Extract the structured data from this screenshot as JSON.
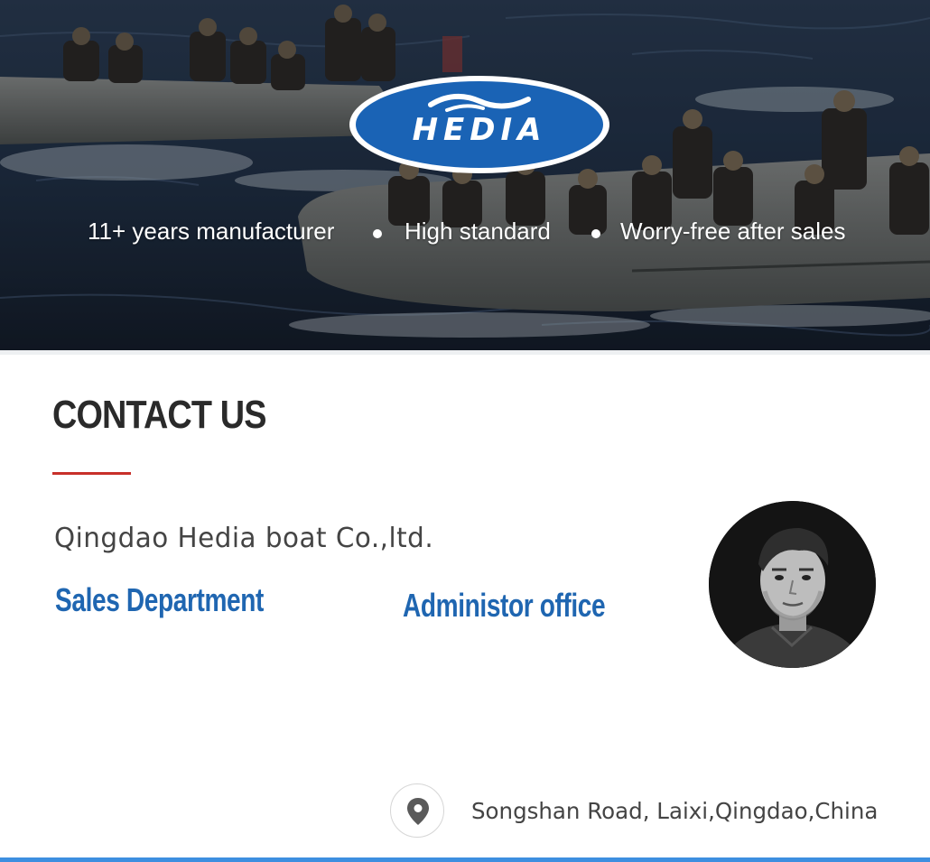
{
  "hero": {
    "brand": "HEDIA",
    "features": [
      "11+ years manufacturer",
      "High standard",
      "Worry-free after sales"
    ]
  },
  "contact": {
    "title": "CONTACT US",
    "company": "Qingdao Hedia boat Co.,ltd.",
    "departments": {
      "sales": "Sales Department",
      "admin": "Administor office"
    },
    "address": "Songshan Road, Laixi,Qingdao,China",
    "address_icon": "map-pin-icon"
  },
  "colors": {
    "accent_red": "#c8302a",
    "brand_blue": "#1f66b1",
    "logo_blue": "#1a63b5",
    "bottom_bar": "#3d8fe0"
  }
}
